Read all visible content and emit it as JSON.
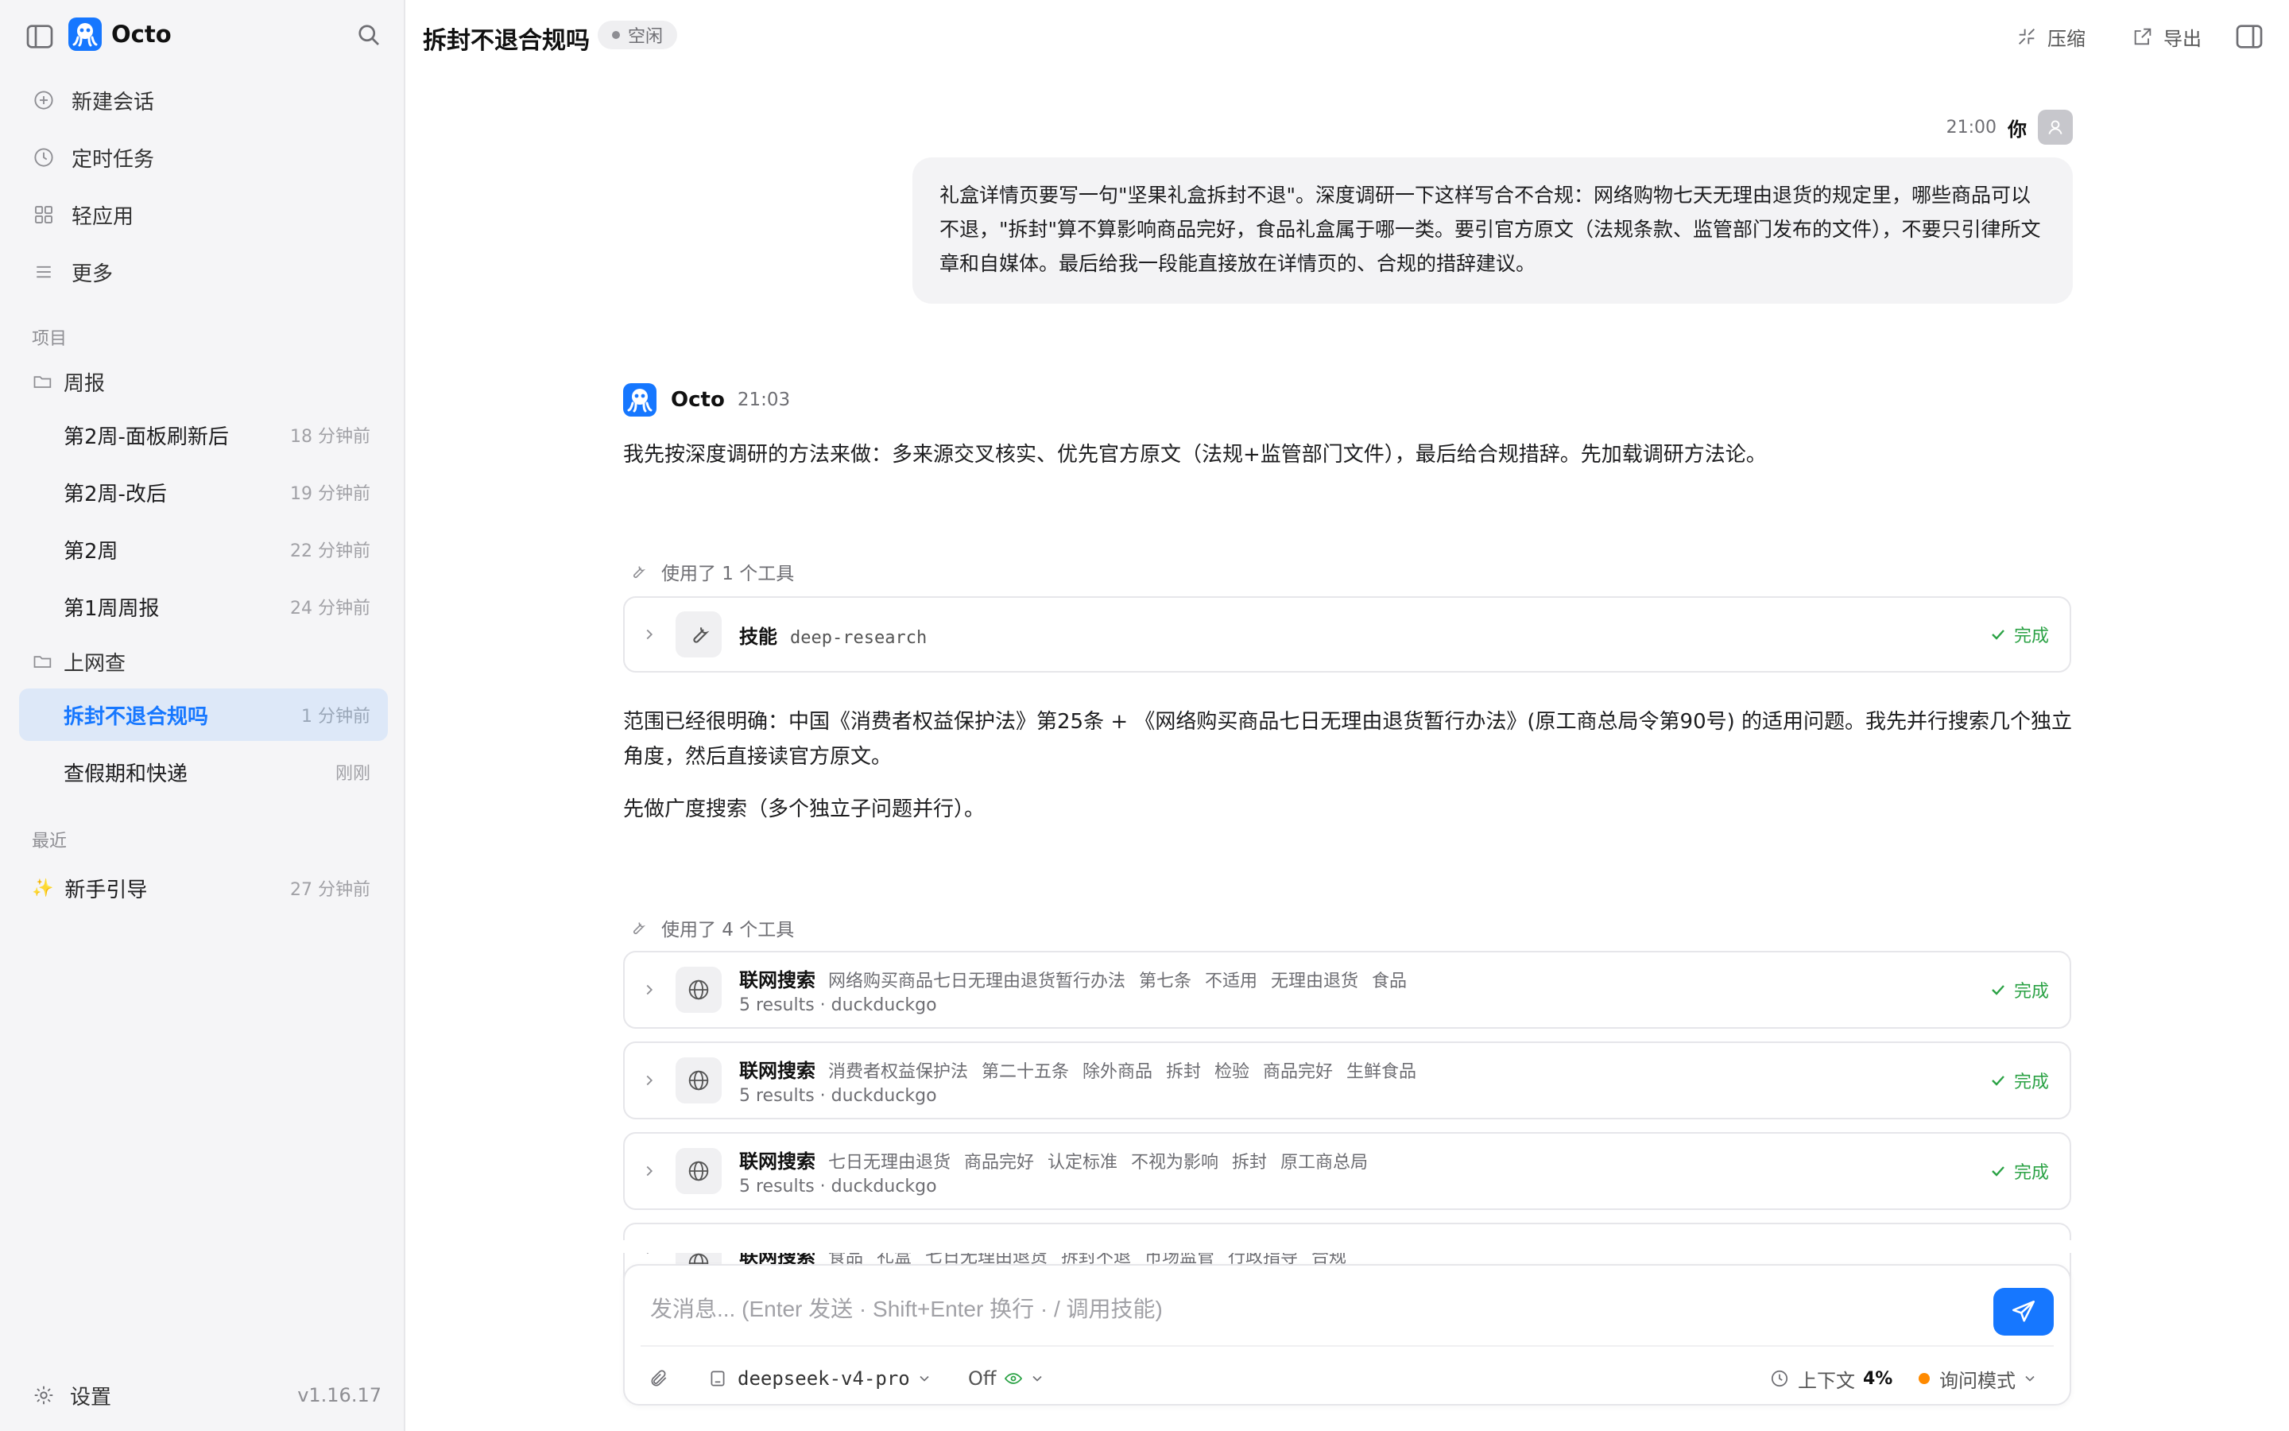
{
  "app": {
    "name": "Octo"
  },
  "sidebar": {
    "nav": [
      {
        "label": "新建会话",
        "icon": "plus-circle-icon"
      },
      {
        "label": "定时任务",
        "icon": "clock-icon"
      },
      {
        "label": "轻应用",
        "icon": "grid-icon"
      },
      {
        "label": "更多",
        "icon": "menu-icon"
      }
    ],
    "projects_label": "项目",
    "folders": [
      {
        "name": "周报",
        "chats": [
          {
            "title": "第2周-面板刷新后",
            "time": "18 分钟前"
          },
          {
            "title": "第2周-改后",
            "time": "19 分钟前"
          },
          {
            "title": "第2周",
            "time": "22 分钟前"
          },
          {
            "title": "第1周周报",
            "time": "24 分钟前"
          }
        ]
      },
      {
        "name": "上网查",
        "chats": [
          {
            "title": "拆封不退合规吗",
            "time": "1 分钟前",
            "active": true
          },
          {
            "title": "查假期和快递",
            "time": "刚刚"
          }
        ]
      }
    ],
    "recent_label": "最近",
    "recent": [
      {
        "title": "新手引导",
        "time": "27 分钟前",
        "icon": "sparkle-icon"
      }
    ],
    "settings_label": "设置",
    "version": "v1.16.17"
  },
  "header": {
    "title": "拆封不退合规吗",
    "status": "空闲",
    "compress_label": "压缩",
    "export_label": "导出"
  },
  "messages": {
    "user": {
      "time": "21:00",
      "name": "你",
      "text": "礼盒详情页要写一句\"坚果礼盒拆封不退\"。深度调研一下这样写合不合规：网络购物七天无理由退货的规定里，哪些商品可以不退，\"拆封\"算不算影响商品完好，食品礼盒属于哪一类。要引官方原文（法规条款、监管部门发布的文件），不要只引律所文章和自媒体。最后给我一段能直接放在详情页的、合规的措辞建议。"
    },
    "assistant": {
      "name": "Octo",
      "time": "21:03",
      "intro": "我先按深度调研的方法来做：多来源交叉核实、优先官方原文（法规+监管部门文件），最后给合规措辞。先加载调研方法论。",
      "tools1_label": "使用了 1 个工具",
      "skill": {
        "name": "技能",
        "arg": "deep-research",
        "status": "完成"
      },
      "para1": "范围已经很明确：中国《消费者权益保护法》第25条 + 《网络购买商品七日无理由退货暂行办法》(原工商总局令第90号) 的适用问题。我先并行搜索几个独立角度，然后直接读官方原文。",
      "para2": "先做广度搜索（多个独立子问题并行）。",
      "tools4_label": "使用了 4 个工具",
      "searches": [
        {
          "name": "联网搜索",
          "query": "网络购买商品七日无理由退货暂行办法 第七条 不适用 无理由退货 食品",
          "meta": "5 results · duckduckgo",
          "status": "完成"
        },
        {
          "name": "联网搜索",
          "query": "消费者权益保护法 第二十五条 除外商品 拆封 检验 商品完好 生鲜食品",
          "meta": "5 results · duckduckgo",
          "status": "完成"
        },
        {
          "name": "联网搜索",
          "query": "七日无理由退货 商品完好 认定标准 不视为影响 拆封 原工商总局",
          "meta": "5 results · duckduckgo",
          "status": "完成"
        },
        {
          "name": "联网搜索",
          "query": "食品 礼盒 七日无理由退货 拆封不退 市场监管 行政指导 合规",
          "meta": "",
          "status": ""
        }
      ]
    }
  },
  "composer": {
    "placeholder": "发消息... (Enter 发送 · Shift+Enter 换行 · / 调用技能)",
    "model": "deepseek-v4-pro",
    "reasoning": "Off",
    "context_label": "上下文",
    "context_value": "4%",
    "mode": "询问模式"
  },
  "colors": {
    "accent": "#1677ff",
    "success": "#2ba245",
    "mode_dot": "#ff8a00"
  }
}
